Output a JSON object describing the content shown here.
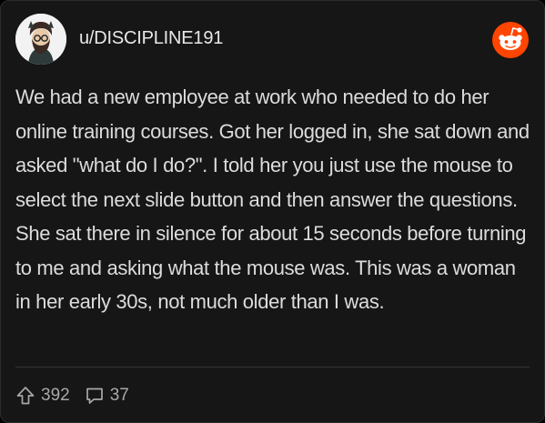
{
  "post": {
    "username": "u/DISCIPLINE191",
    "body": "We had a new employee at work who needed to do her online training courses. Got her logged in, she sat down and asked \"what do I do?\". I told her you just use the mouse to select the next slide button and then answer the questions. She sat there in silence for about 15 seconds before turning to me and asking what the mouse was. This was a woman in her early 30s, not much older than I was."
  },
  "stats": {
    "upvotes": "392",
    "comments": "37"
  },
  "icons": {
    "avatar": "avatar-cartoon",
    "brand": "reddit-logo-icon",
    "upvote": "upvote-arrow-icon",
    "comment": "comment-bubble-icon"
  },
  "colors": {
    "background": "#000000",
    "card": "#161616",
    "text": "#dcdcdc",
    "muted": "#a9a9a9",
    "reddit_orange": "#ff4500"
  }
}
